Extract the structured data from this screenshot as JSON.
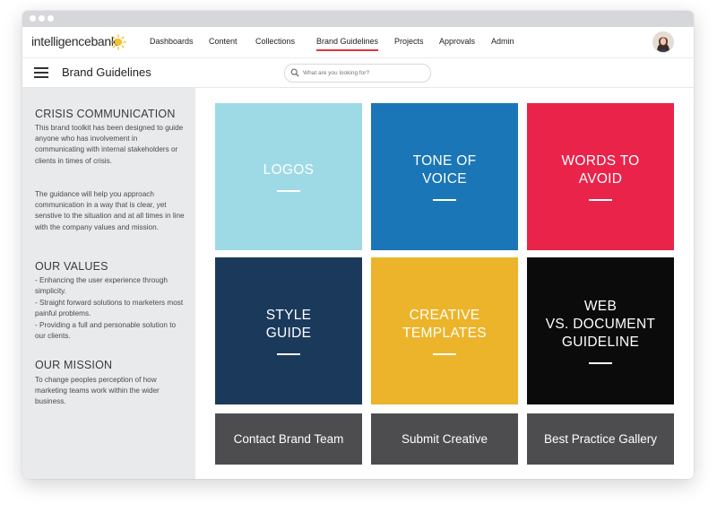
{
  "app": {
    "logo_text": "intelligencebank"
  },
  "nav": {
    "items": [
      "Dashboards",
      "Content",
      "Collections",
      "Brand Guidelines",
      "Projects",
      "Approvals",
      "Admin"
    ],
    "active": "Brand Guidelines",
    "accent_color": "#e8323f"
  },
  "header": {
    "title": "Brand Guidelines"
  },
  "search": {
    "placeholder": "What are you looking for?"
  },
  "sidebar": {
    "sections": [
      {
        "heading": "CRISIS COMMUNICATION",
        "text": "This brand toolkit has been designed to guide anyone who has involvement in communicating with internal stakeholders or clients in times of crisis.",
        "text2": "The guidance will help you approach communication in a way that is clear, yet senstive to the situation and at all times in line with the company values and mission."
      },
      {
        "heading": "OUR VALUES",
        "lines": [
          "- Enhancing the user experience through simplicity.",
          "- Straight forward solutions to marketers most painful problems.",
          "- Providing a full and personable solution to our clients."
        ]
      },
      {
        "heading": "OUR MISSION",
        "text": "To change peoples perception of how marketing teams work within the wider business."
      }
    ]
  },
  "tiles": [
    {
      "title": "LOGOS",
      "color": "#9ed9e6"
    },
    {
      "title": "TONE OF\nVOICE",
      "color": "#1a76b6"
    },
    {
      "title": "WORDS TO\nAVOID",
      "color": "#e9234a"
    },
    {
      "title": "STYLE\nGUIDE",
      "color": "#1b3a5b"
    },
    {
      "title": "CREATIVE\nTEMPLATES",
      "color": "#ecb42a"
    },
    {
      "title": "WEB\nVS. DOCUMENT\nGUIDELINE",
      "color": "#0b0b0c"
    }
  ],
  "buttons": [
    {
      "label": "Contact Brand Team"
    },
    {
      "label": "Submit Creative"
    },
    {
      "label": "Best Practice Gallery"
    }
  ]
}
